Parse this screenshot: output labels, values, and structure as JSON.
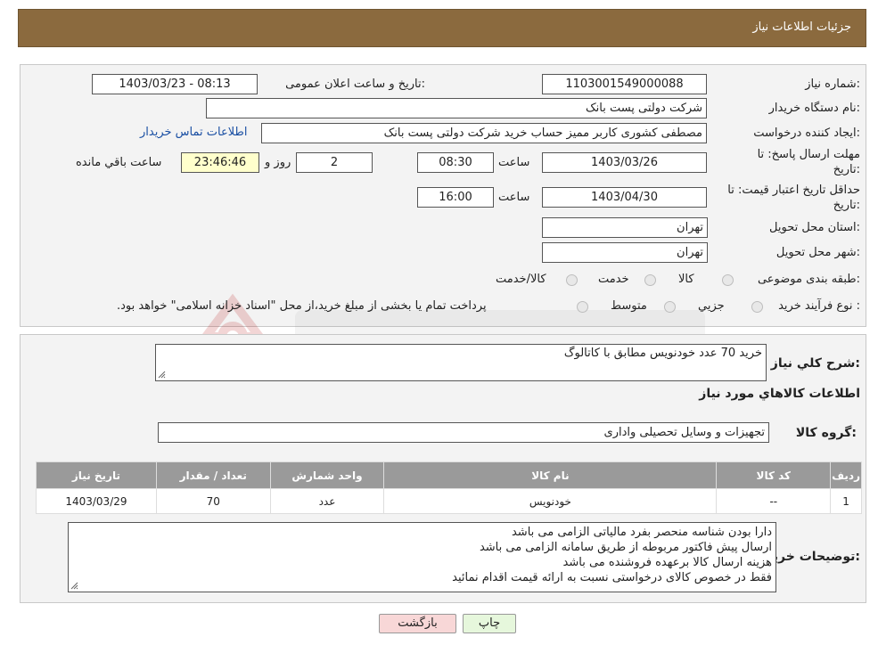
{
  "header": {
    "title": "جزئیات اطلاعات نیاز"
  },
  "info": {
    "need_number_label": "شماره نیاز:",
    "need_number": "1103001549000088",
    "announce_label": "تاریخ و ساعت اعلان عمومی:",
    "announce_value": "1403/03/23 - 08:13",
    "buyer_org_label": "نام دستگاه خریدار:",
    "buyer_org": "شرکت دولتی پست بانک",
    "creator_label": "ایجاد کننده درخواست:",
    "creator": "مصطفی کشوری کاربر ممیز حساب خرید شرکت دولتی پست بانک",
    "contact_link": "اطلاعات تماس خریدار",
    "deadline_label_1": "مهلت ارسال پاسخ: تا",
    "deadline_label_2": "تاریخ:",
    "deadline_date": "1403/03/26",
    "time_label": "ساعت",
    "deadline_time": "08:30",
    "days_value": "2",
    "days_label": "روز و",
    "remaining_time": "23:46:46",
    "remaining_label": "ساعت باقي مانده",
    "validity_label_1": "حداقل تاریخ اعتبار قیمت: تا",
    "validity_label_2": "تاریخ:",
    "validity_date": "1403/04/30",
    "validity_time": "16:00",
    "province_label": "استان محل تحویل:",
    "province": "تهران",
    "city_label": "شهر محل تحویل:",
    "city": "تهران",
    "category_label": "طبقه بندی موضوعی:",
    "category_options": [
      "کالا",
      "خدمت",
      "کالا/خدمت"
    ],
    "process_label": "نوع فرآیند خرید :",
    "process_options": [
      "جزيي",
      "متوسط"
    ],
    "process_note": "پرداخت تمام یا بخشی از مبلغ خرید،از محل \"اسناد خزانه اسلامی\" خواهد بود."
  },
  "details": {
    "summary_label": "شرح کلي نياز:",
    "summary": "خرید 70 عدد خودنویس مطابق با کاتالوگ",
    "goods_info_title": "اطلاعات کالاهاي مورد نياز",
    "goods_group_label": "گروه کالا:",
    "goods_group": "تجهیزات و وسایل تحصیلی واداری",
    "table": {
      "headers": [
        "رديف",
        "کد کالا",
        "نام کالا",
        "واحد شمارش",
        "تعداد / مقدار",
        "تاریخ نیاز"
      ],
      "rows": [
        [
          "1",
          "--",
          "خودنویس",
          "عدد",
          "70",
          "1403/03/29"
        ]
      ]
    },
    "buyer_notes_label": "توضیحات خریدار:",
    "buyer_notes": [
      "دارا بودن شناسه منحصر بفرد مالیاتی الزامی می باشد",
      "ارسال پیش فاکتور مربوطه از طریق سامانه الزامی می باشد",
      "هزینه ارسال کالا برعهده فروشنده می باشد",
      "فقط در خصوص کالای درخواستی نسبت به ارائه قیمت اقدام نمائید"
    ]
  },
  "buttons": {
    "print": "چاپ",
    "back": "بازگشت"
  },
  "colors": {
    "header_bg": "#8b6a3e",
    "back_button_bg": "#f8d7d7",
    "print_button_bg": "#e6f7dc"
  }
}
